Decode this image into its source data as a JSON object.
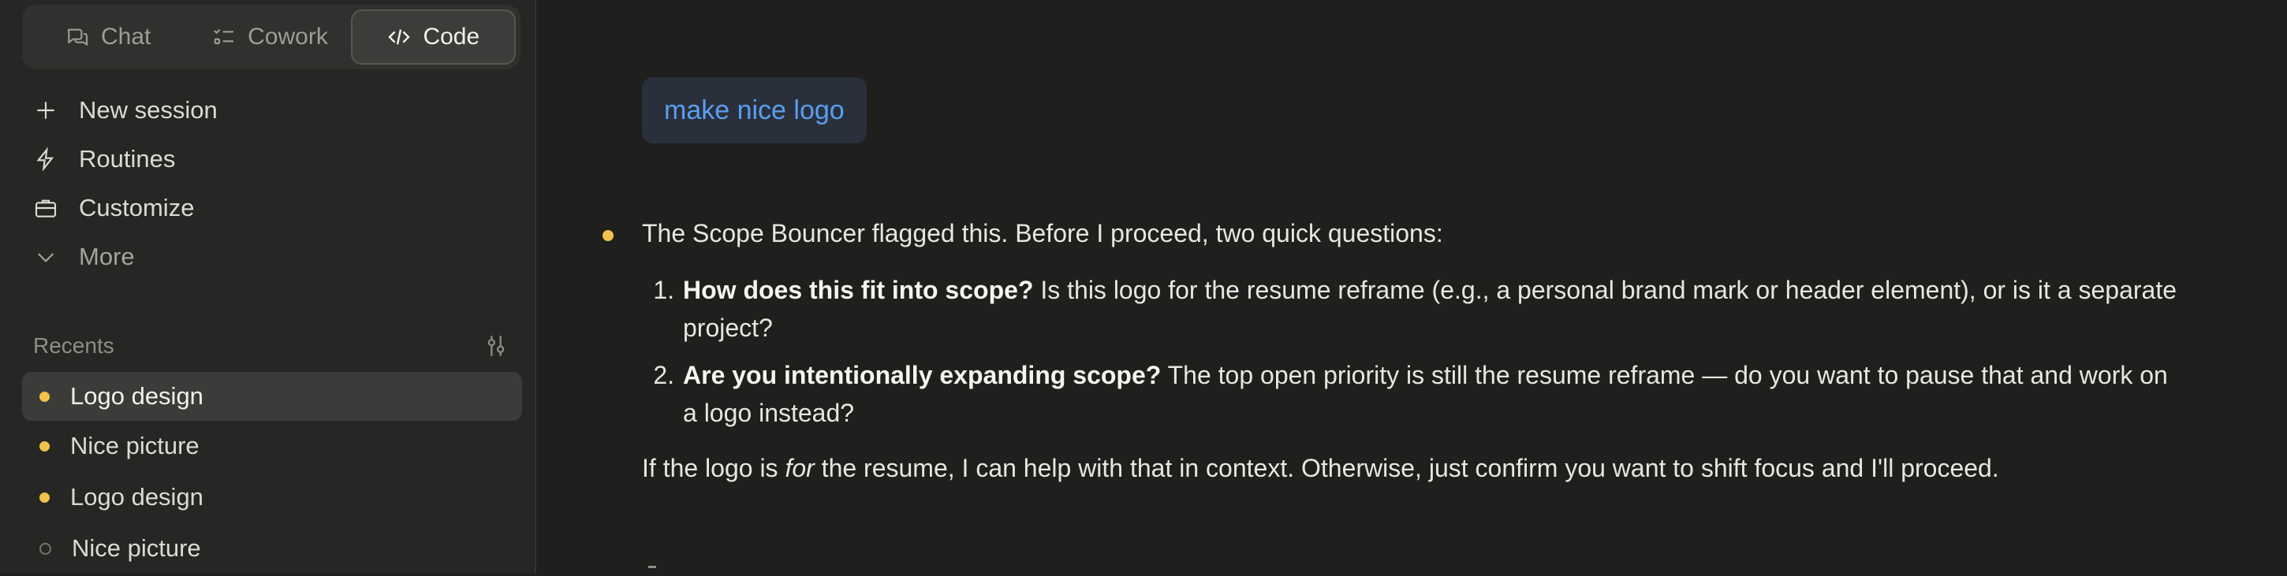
{
  "sidebar": {
    "modes": [
      {
        "label": "Chat",
        "icon": "chat-bubbles-icon",
        "active": false
      },
      {
        "label": "Cowork",
        "icon": "checklist-icon",
        "active": false
      },
      {
        "label": "Code",
        "icon": "code-icon",
        "active": true
      }
    ],
    "nav": [
      {
        "label": "New session",
        "icon": "plus-icon"
      },
      {
        "label": "Routines",
        "icon": "lightning-icon"
      },
      {
        "label": "Customize",
        "icon": "briefcase-icon"
      },
      {
        "label": "More",
        "icon": "chevron-down-icon"
      }
    ],
    "recents_label": "Recents",
    "recents": [
      {
        "label": "Logo design",
        "status": "active-dot",
        "selected": true
      },
      {
        "label": "Nice picture",
        "status": "active-dot",
        "selected": false
      },
      {
        "label": "Logo design",
        "status": "active-dot",
        "selected": false
      },
      {
        "label": "Nice picture",
        "status": "idle-dot",
        "selected": false
      }
    ]
  },
  "conversation": {
    "user_message": "make nice logo",
    "assistant": {
      "intro": "The Scope Bouncer flagged this. Before I proceed, two quick questions:",
      "questions": [
        {
          "bold": "How does this fit into scope?",
          "text": " Is this logo for the resume reframe (e.g., a personal brand mark or header element), or is it a separate project?"
        },
        {
          "bold": "Are you intentionally expanding scope?",
          "text": " The top open priority is still the resume reframe — do you want to pause that and work on a logo instead?"
        }
      ],
      "followup_a": "If the logo is ",
      "followup_em": "for",
      "followup_b": " the resume, I can help with that in context. Otherwise, just confirm you want to shift focus and I'll proceed."
    }
  },
  "colors": {
    "accent_dot": "#f2c24b",
    "user_text": "#5a9ef0",
    "background": "#1f1f1e"
  }
}
